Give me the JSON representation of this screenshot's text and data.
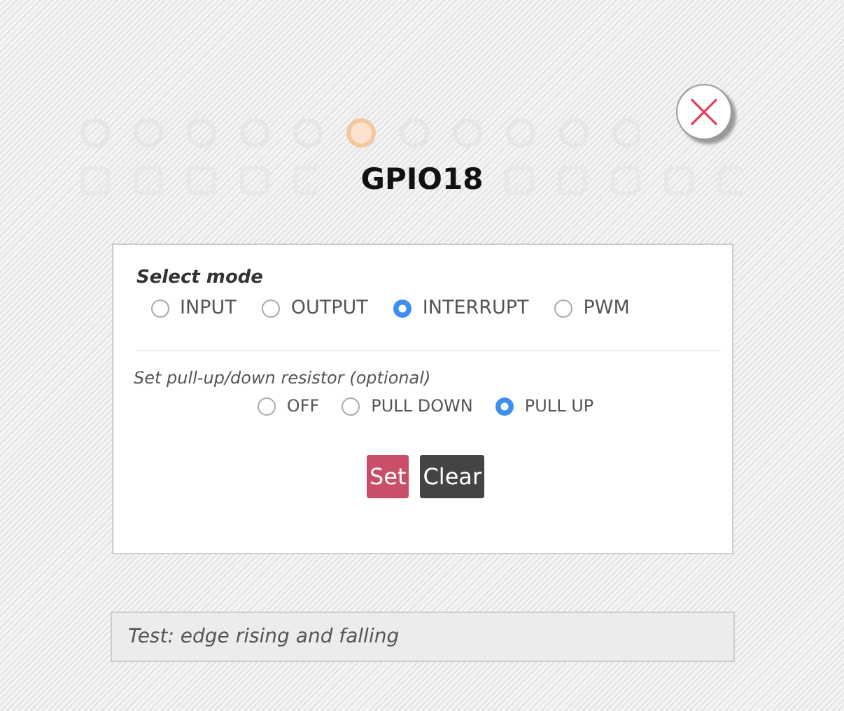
{
  "pin": {
    "title": "GPIO18"
  },
  "mode": {
    "label": "Select mode",
    "options": [
      {
        "label": "INPUT",
        "selected": false
      },
      {
        "label": "OUTPUT",
        "selected": false
      },
      {
        "label": "INTERRUPT",
        "selected": true
      },
      {
        "label": "PWM",
        "selected": false
      }
    ]
  },
  "resistor": {
    "label": "Set pull-up/down resistor (optional)",
    "options": [
      {
        "label": "OFF",
        "selected": false
      },
      {
        "label": "PULL DOWN",
        "selected": false
      },
      {
        "label": "PULL UP",
        "selected": true
      }
    ]
  },
  "buttons": [
    {
      "label": "Set",
      "kind": "primary"
    },
    {
      "label": "Clear",
      "kind": "secondary"
    }
  ],
  "note": "Test: edge rising and falling"
}
